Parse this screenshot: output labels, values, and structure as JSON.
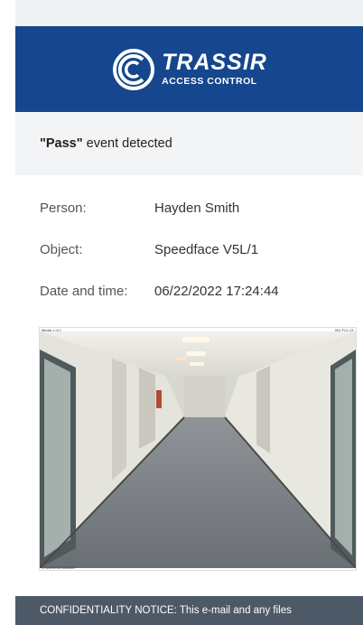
{
  "header": {
    "brand_name": "TRASSIR",
    "brand_sub": "ACCESS CONTROL",
    "logo_icon": "trassir-logo-icon",
    "background_color": "#15468e"
  },
  "event": {
    "name": "\"Pass\"",
    "suffix": " event detected"
  },
  "details": [
    {
      "label": "Person:",
      "value": "Hayden Smith"
    },
    {
      "label": "Object:",
      "value": "Speedface V5L/1"
    },
    {
      "label": "Date and time:",
      "value": "06/22/2022 17:24:44"
    }
  ],
  "snapshot": {
    "caption_left": "Media 1 of 1",
    "caption_right": "001 FCL-21",
    "caption_bottom": "17:24:44 22.06.2022"
  },
  "footer": {
    "notice": "CONFIDENTIALITY NOTICE: This e-mail and any files"
  }
}
